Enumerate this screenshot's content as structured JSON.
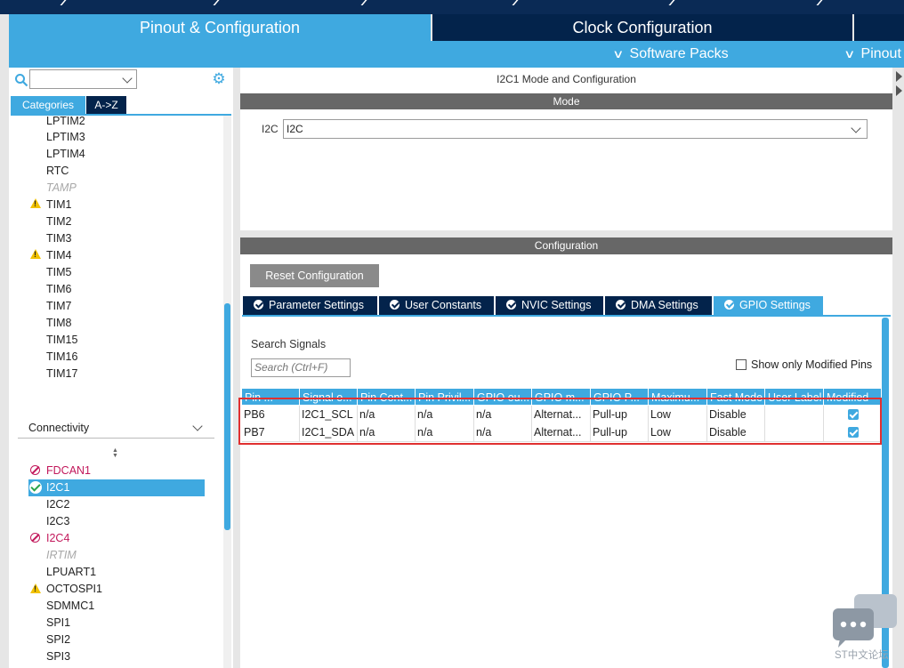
{
  "main_tabs": {
    "pinout": "Pinout & Configuration",
    "clock": "Clock Configuration"
  },
  "submenus": {
    "software_packs": "Software Packs",
    "pinout": "Pinout"
  },
  "left_panel": {
    "tabs": {
      "categories": "Categories",
      "az": "A->Z"
    },
    "timers": [
      {
        "label": "LPTIM2",
        "status": "normal"
      },
      {
        "label": "LPTIM3",
        "status": "normal"
      },
      {
        "label": "LPTIM4",
        "status": "normal"
      },
      {
        "label": "RTC",
        "status": "normal"
      },
      {
        "label": "TAMP",
        "status": "disabled"
      },
      {
        "label": "TIM1",
        "status": "warning"
      },
      {
        "label": "TIM2",
        "status": "normal"
      },
      {
        "label": "TIM3",
        "status": "normal"
      },
      {
        "label": "TIM4",
        "status": "warning"
      },
      {
        "label": "TIM5",
        "status": "normal"
      },
      {
        "label": "TIM6",
        "status": "normal"
      },
      {
        "label": "TIM7",
        "status": "normal"
      },
      {
        "label": "TIM8",
        "status": "normal"
      },
      {
        "label": "TIM15",
        "status": "normal"
      },
      {
        "label": "TIM16",
        "status": "normal"
      },
      {
        "label": "TIM17",
        "status": "normal"
      }
    ],
    "connectivity_header": "Connectivity",
    "connectivity": [
      {
        "label": "FDCAN1",
        "status": "error"
      },
      {
        "label": "I2C1",
        "status": "selected"
      },
      {
        "label": "I2C2",
        "status": "normal"
      },
      {
        "label": "I2C3",
        "status": "normal"
      },
      {
        "label": "I2C4",
        "status": "error"
      },
      {
        "label": "IRTIM",
        "status": "disabled"
      },
      {
        "label": "LPUART1",
        "status": "normal"
      },
      {
        "label": "OCTOSPI1",
        "status": "warning"
      },
      {
        "label": "SDMMC1",
        "status": "normal"
      },
      {
        "label": "SPI1",
        "status": "normal"
      },
      {
        "label": "SPI2",
        "status": "normal"
      },
      {
        "label": "SPI3",
        "status": "normal"
      }
    ]
  },
  "mode_panel": {
    "title": "I2C1 Mode and Configuration",
    "mode_bar": "Mode",
    "i2c_label": "I2C",
    "i2c_value": "I2C"
  },
  "config_panel": {
    "bar": "Configuration",
    "reset_button": "Reset Configuration",
    "tabs": [
      {
        "label": "Parameter Settings",
        "active": false
      },
      {
        "label": "User Constants",
        "active": false
      },
      {
        "label": "NVIC Settings",
        "active": false
      },
      {
        "label": "DMA Settings",
        "active": false
      },
      {
        "label": "GPIO Settings",
        "active": true
      }
    ],
    "search_label": "Search Signals",
    "search_placeholder": "Search (Ctrl+F)",
    "show_modified": "Show only Modified Pins",
    "columns": [
      "Pin ...",
      "Signal o...",
      "Pin Cont...",
      "Pin Privil...",
      "GPIO ou...",
      "GPIO m...",
      "GPIO P...",
      "Maximu...",
      "Fast Mode",
      "User Label",
      "Modified"
    ],
    "rows": [
      [
        "PB6",
        "I2C1_SCL",
        "n/a",
        "n/a",
        "n/a",
        "Alternat...",
        "Pull-up",
        "Low",
        "Disable",
        "",
        true
      ],
      [
        "PB7",
        "I2C1_SDA",
        "n/a",
        "n/a",
        "n/a",
        "Alternat...",
        "Pull-up",
        "Low",
        "Disable",
        "",
        true
      ]
    ]
  },
  "watermark": "ST中文论坛",
  "colors": {
    "accent": "#3fa9e0",
    "navy": "#03234b",
    "gray_bar": "#676767",
    "highlight": "#e03030"
  }
}
